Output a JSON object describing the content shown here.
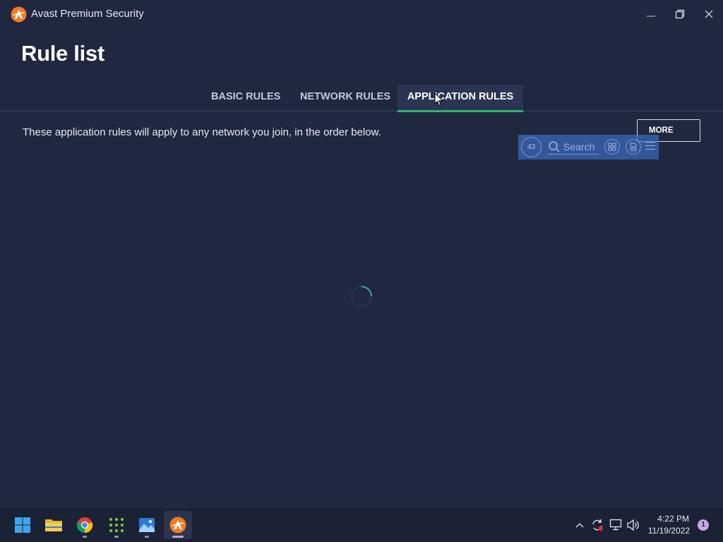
{
  "window": {
    "app_title": "Avast Premium Security",
    "logo_icon": "avast-logo-icon",
    "controls": [
      "minimize-icon",
      "restore-icon",
      "close-icon"
    ]
  },
  "page": {
    "title": "Rule list",
    "tabs": [
      {
        "label": "BASIC RULES",
        "selected": false
      },
      {
        "label": "NETWORK RULES",
        "selected": false
      },
      {
        "label": "APPLICATION RULES",
        "selected": true
      }
    ],
    "description": "These application rules will apply to any network you join, in the order below.",
    "more_label": "MORE",
    "loading": true
  },
  "overlay_toolbar": {
    "timer": "43",
    "search_placeholder": "Search",
    "icons": [
      "grid-icon",
      "document-icon",
      "menu-icon"
    ]
  },
  "taskbar": {
    "apps": [
      {
        "name": "Start",
        "icon": "windows-start-icon"
      },
      {
        "name": "File Explorer",
        "icon": "folder-icon"
      },
      {
        "name": "Google Chrome",
        "icon": "chrome-icon"
      },
      {
        "name": "Dots app",
        "icon": "dots-grid-icon"
      },
      {
        "name": "Photos",
        "icon": "photos-icon"
      },
      {
        "name": "Avast Premium Security",
        "icon": "avast-logo-icon",
        "active": true
      }
    ],
    "tray_icons": [
      "chevron-up-icon",
      "sync-icon",
      "network-icon",
      "volume-icon"
    ],
    "time": "4:22 PM",
    "date": "11/19/2022",
    "notification_count": "1"
  },
  "colors": {
    "background": "#202840",
    "accent_green": "#28b86a",
    "avast_orange": "#f47b20",
    "taskbar": "#1b2236"
  }
}
